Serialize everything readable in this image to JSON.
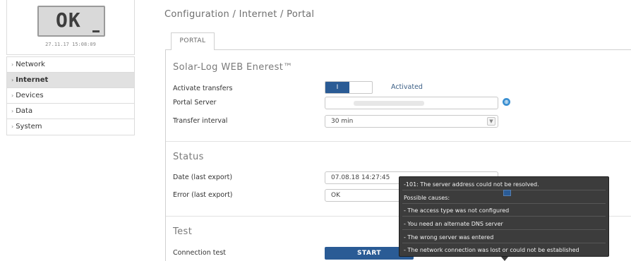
{
  "device": {
    "lcd_text": "OK",
    "datetime": "27.11.17 15:08:09"
  },
  "nav": {
    "items": [
      {
        "label": "Network",
        "active": false
      },
      {
        "label": "Internet",
        "active": true
      },
      {
        "label": "Devices",
        "active": false
      },
      {
        "label": "Data",
        "active": false
      },
      {
        "label": "System",
        "active": false
      }
    ],
    "chevron": "›"
  },
  "breadcrumb": "Configuration / Internet / Portal",
  "tabs": [
    {
      "label": "PORTAL",
      "active": true
    }
  ],
  "portal_section": {
    "title": "Solar-Log WEB Enerest™",
    "activate_transfers_label": "Activate transfers",
    "toggle_on_label": "I",
    "toggle_status": "Activated",
    "portal_server_label": "Portal Server",
    "portal_server_value": "",
    "transfer_interval_label": "Transfer interval",
    "transfer_interval_value": "30 min",
    "globe_icon": "globe-icon"
  },
  "status_section": {
    "title": "Status",
    "date_label": "Date (last export)",
    "date_value": "07.08.18 14:27:45",
    "error_label": "Error (last export)",
    "error_value": "OK"
  },
  "test_section": {
    "title": "Test",
    "connection_test_label": "Connection test",
    "start_button": "START"
  },
  "tooltip": {
    "heading": "-101: The server address could not be resolved.",
    "causes_label": "Possible causes:",
    "causes": [
      "- The access type was not configured",
      "- You need an alternate DNS server",
      "- The wrong server was entered",
      "- The network connection was lost or could not be established"
    ]
  },
  "colors": {
    "accent": "#2a5b95",
    "tooltip_bg": "#3c3c3c",
    "nav_active_bg": "#e1e1e1"
  }
}
